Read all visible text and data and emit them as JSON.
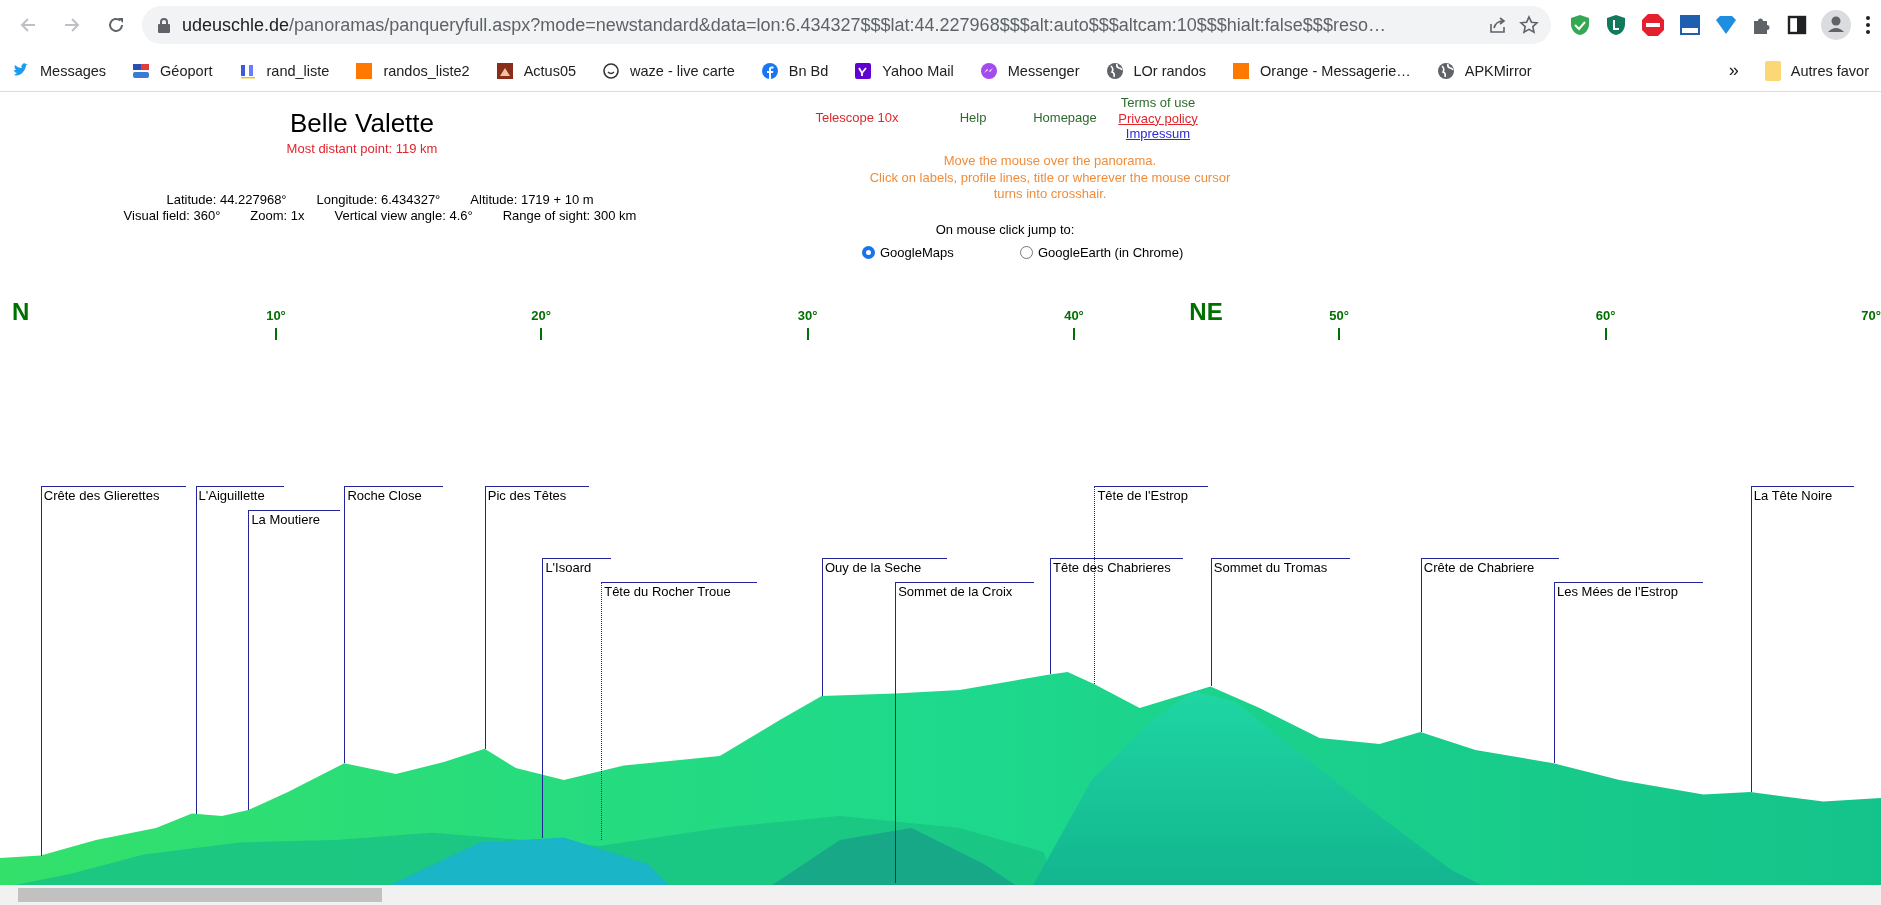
{
  "browser": {
    "url": {
      "host": "udeuschle.de",
      "path": "/panoramas/panqueryfull.aspx?mode=newstandard&data=lon:6.434327$$$lat:44.227968$$$alt:auto$$$altcam:10$$$hialt:false$$$reso…"
    },
    "bookmarks": [
      {
        "label": "Messages",
        "kind": "bird"
      },
      {
        "label": "Géoport",
        "kind": "flag"
      },
      {
        "label": "rand_liste",
        "kind": "letters"
      },
      {
        "label": "randos_liste2",
        "kind": "orange"
      },
      {
        "label": "Actus05",
        "kind": "brown"
      },
      {
        "label": "waze - live  carte",
        "kind": "smile"
      },
      {
        "label": "Bn Bd",
        "kind": "facebook"
      },
      {
        "label": "Yahoo Mail",
        "kind": "purple"
      },
      {
        "label": "Messenger",
        "kind": "messenger"
      },
      {
        "label": "LOr randos",
        "kind": "globe"
      },
      {
        "label": "Orange - Messagerie…",
        "kind": "orange"
      },
      {
        "label": "APKMirror",
        "kind": "globe"
      }
    ],
    "overflow": "»",
    "other_bookmarks": "Autres favor"
  },
  "page": {
    "title": "Belle Valette",
    "subtitle": "Most distant point: 119 km",
    "info_lines": [
      [
        "Latitude: 44.227968°",
        "Longitude: 6.434327°",
        "Altitude: 1719 + 10 m"
      ],
      [
        "Visual field: 360°",
        "Zoom: 1x",
        "Vertical view angle: 4.6°",
        "Range of sight: 300 km"
      ]
    ],
    "links": [
      {
        "label": "Telescope 10x",
        "color": "#e0262c",
        "underlined": false
      },
      {
        "label": "Help",
        "color": "#2d6b2d",
        "underlined": false
      },
      {
        "label": "Homepage",
        "color": "#2d6b2d",
        "underlined": false
      },
      {
        "label": "Terms of use",
        "color": "#2d6b2d",
        "underlined": false
      },
      {
        "label": "Privacy policy",
        "color": "#e0262c",
        "underlined": true
      },
      {
        "label": "Impressum",
        "color": "#2b2bd8",
        "underlined": true
      }
    ],
    "hint_lines": [
      "Move the mouse over the panorama.",
      "Click on labels, profile lines, title or wherever the mouse cursor",
      "turns into crosshair."
    ],
    "jump_label": "On mouse click jump to:",
    "jump_options": [
      {
        "label": "GoogleMaps",
        "selected": true
      },
      {
        "label": "GoogleEarth (in Chrome)",
        "selected": false
      }
    ]
  },
  "panorama": {
    "compass": [
      {
        "label": "N",
        "kind": "cardinal"
      },
      {
        "label": "10°",
        "kind": "degree"
      },
      {
        "label": "20°",
        "kind": "degree"
      },
      {
        "label": "30°",
        "kind": "degree"
      },
      {
        "label": "40°",
        "kind": "degree"
      },
      {
        "label": "NE",
        "kind": "cardinal"
      },
      {
        "label": "50°",
        "kind": "degree"
      },
      {
        "label": "60°",
        "kind": "degree"
      },
      {
        "label": "70°",
        "kind": "degree"
      }
    ],
    "peaks": [
      {
        "name": "Crête des Glierettes",
        "dotted": false
      },
      {
        "name": "L'Aiguillette",
        "dotted": false
      },
      {
        "name": "La Moutiere",
        "dotted": false
      },
      {
        "name": "Roche Close",
        "dotted": false
      },
      {
        "name": "Pic des Têtes",
        "dotted": false
      },
      {
        "name": "L'Isoard",
        "dotted": false
      },
      {
        "name": "Tête du Rocher Troue",
        "dotted": true
      },
      {
        "name": "Ouy de la Seche",
        "dotted": false
      },
      {
        "name": "Sommet de la Croix",
        "dotted": false
      },
      {
        "name": "Tête de l'Estrop",
        "dotted": true
      },
      {
        "name": "Tête des Chabrieres",
        "dotted": false
      },
      {
        "name": "Sommet du Tromas",
        "dotted": false
      },
      {
        "name": "Crête de Chabriere",
        "dotted": false
      },
      {
        "name": "Les Mées de l'Estrop",
        "dotted": false
      },
      {
        "name": "La Tête Noire",
        "dotted": false
      }
    ]
  }
}
